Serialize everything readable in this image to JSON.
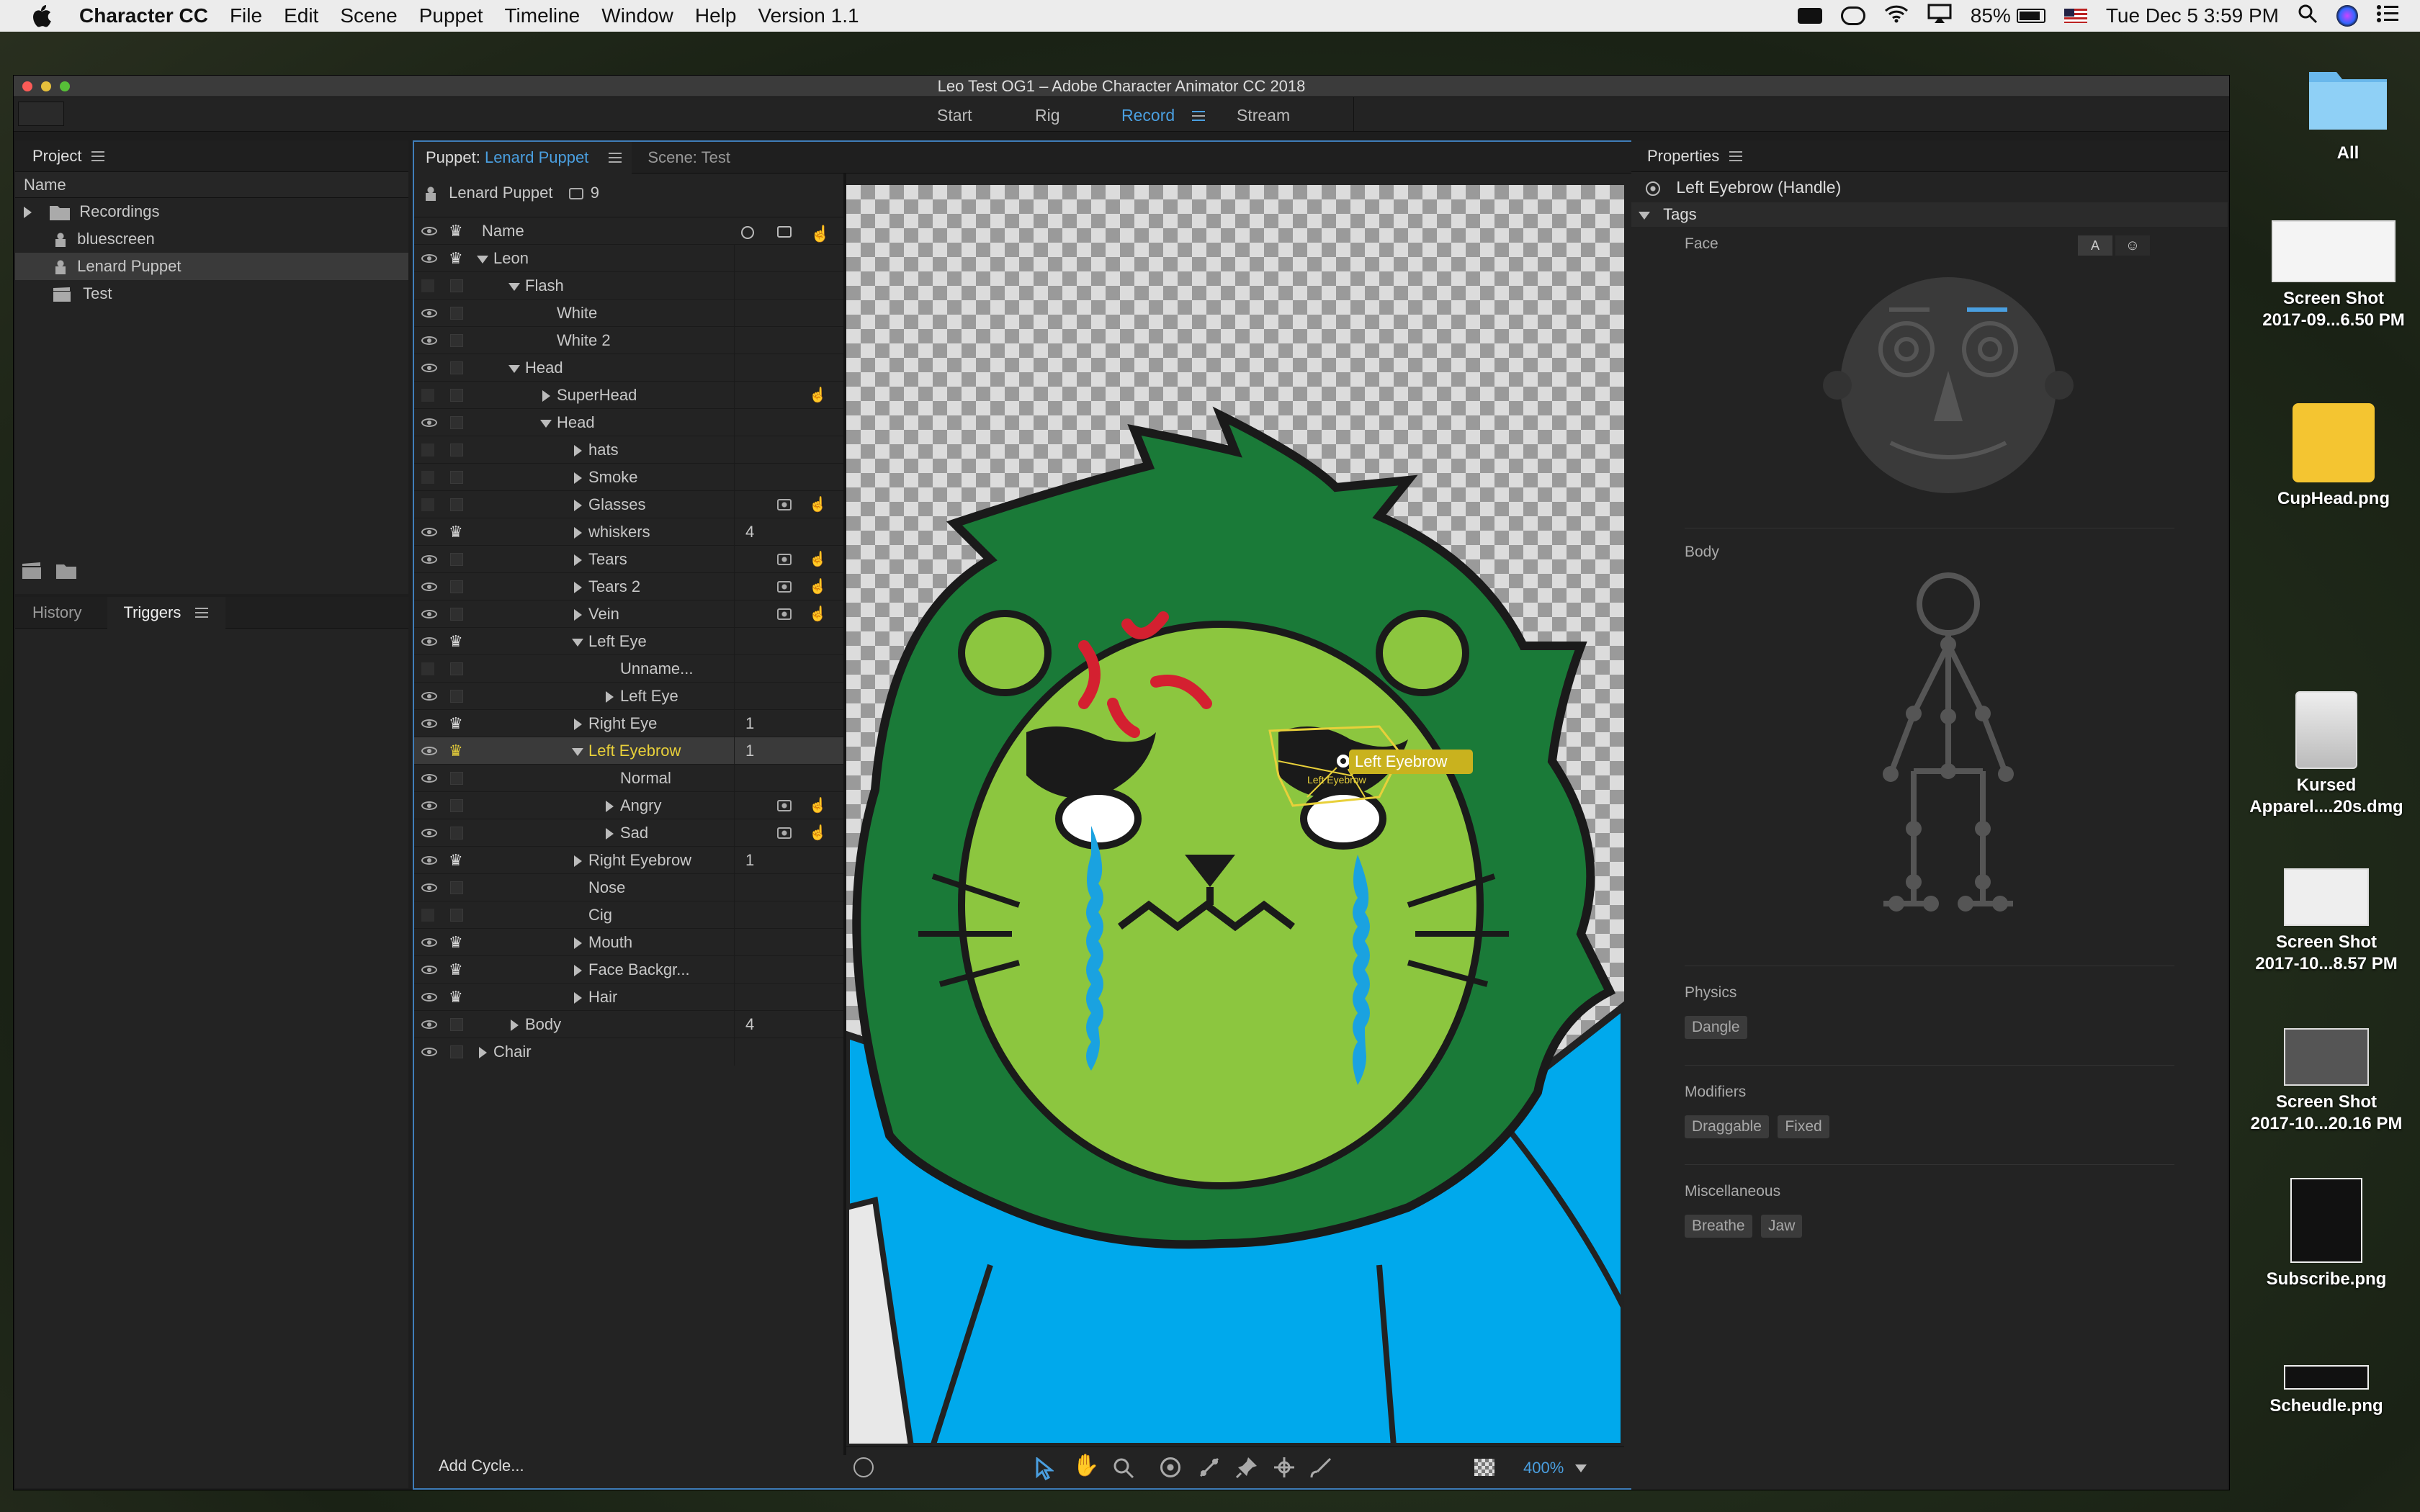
{
  "menubar": {
    "app": "Character CC",
    "items": [
      "File",
      "Edit",
      "Scene",
      "Puppet",
      "Timeline",
      "Window",
      "Help",
      "Version 1.1"
    ],
    "battery": "85%",
    "clock": "Tue Dec 5  3:59 PM"
  },
  "window": {
    "title": "Leo Test OG1 – Adobe Character Animator CC 2018",
    "modes": [
      "Start",
      "Rig",
      "Record",
      "Stream"
    ],
    "active_mode": "Record"
  },
  "project": {
    "title": "Project",
    "col": "Name",
    "items": [
      "Recordings",
      "bluescreen",
      "Lenard Puppet",
      "Test"
    ]
  },
  "lower_tabs": {
    "history": "History",
    "triggers": "Triggers"
  },
  "puppet": {
    "tab_prefix": "Puppet: ",
    "tab_name": "Lenard Puppet",
    "scene_tab": "Scene: Test",
    "header_name": "Lenard Puppet",
    "header_count": "9",
    "col": "Name",
    "add_cycle": "Add Cycle..."
  },
  "layers": [
    {
      "n": "Leon",
      "d": 1,
      "t": "d",
      "crown": true,
      "eye": true
    },
    {
      "n": "Flash",
      "d": 2,
      "t": "d",
      "eye": false
    },
    {
      "n": "White",
      "d": 3,
      "t": "n",
      "eye": true
    },
    {
      "n": "White 2",
      "d": 3,
      "t": "n",
      "eye": true
    },
    {
      "n": "Head",
      "d": 2,
      "t": "d",
      "eye": true
    },
    {
      "n": "SuperHead",
      "d": 3,
      "t": "r",
      "eye": false,
      "hand": true
    },
    {
      "n": "Head",
      "d": 3,
      "t": "d",
      "eye": true
    },
    {
      "n": "hats",
      "d": 4,
      "t": "r",
      "eye": false
    },
    {
      "n": "Smoke",
      "d": 4,
      "t": "r",
      "eye": false
    },
    {
      "n": "Glasses",
      "d": 4,
      "t": "r",
      "eye": false,
      "cam": true,
      "hand": true
    },
    {
      "n": "whiskers",
      "d": 4,
      "t": "r",
      "crown": true,
      "eye": true,
      "num": "4"
    },
    {
      "n": "Tears",
      "d": 4,
      "t": "r",
      "eye": true,
      "cam": true,
      "hand": true
    },
    {
      "n": "Tears 2",
      "d": 4,
      "t": "r",
      "eye": true,
      "cam": true,
      "hand": true
    },
    {
      "n": "Vein",
      "d": 4,
      "t": "r",
      "eye": true,
      "cam": true,
      "hand": true
    },
    {
      "n": "Left Eye",
      "d": 4,
      "t": "d",
      "crown": true,
      "eye": true
    },
    {
      "n": "Unname...",
      "d": 5,
      "t": "n",
      "eye": false
    },
    {
      "n": "Left Eye",
      "d": 5,
      "t": "r",
      "eye": true
    },
    {
      "n": "Right Eye",
      "d": 4,
      "t": "r",
      "crown": true,
      "eye": true,
      "num": "1"
    },
    {
      "n": "Left Eyebrow",
      "d": 4,
      "t": "d",
      "crown": true,
      "eye": true,
      "num": "1",
      "sel": true
    },
    {
      "n": "Normal",
      "d": 5,
      "t": "n",
      "eye": true
    },
    {
      "n": "Angry",
      "d": 5,
      "t": "r",
      "eye": true,
      "cam": true,
      "hand": true
    },
    {
      "n": "Sad",
      "d": 5,
      "t": "r",
      "eye": true,
      "cam": true,
      "hand": true
    },
    {
      "n": "Right Eyebrow",
      "d": 4,
      "t": "r",
      "crown": true,
      "eye": true,
      "num": "1"
    },
    {
      "n": "Nose",
      "d": 4,
      "t": "n",
      "eye": true
    },
    {
      "n": "Cig",
      "d": 4,
      "t": "n",
      "eye": false
    },
    {
      "n": "Mouth",
      "d": 4,
      "t": "r",
      "crown": true,
      "eye": true
    },
    {
      "n": "Face Backgr...",
      "d": 4,
      "t": "r",
      "crown": true,
      "eye": true
    },
    {
      "n": "Hair",
      "d": 4,
      "t": "r",
      "crown": true,
      "eye": true
    },
    {
      "n": "Body",
      "d": 2,
      "t": "r",
      "eye": true,
      "num": "4"
    },
    {
      "n": "Chair",
      "d": 1,
      "t": "r",
      "eye": true
    }
  ],
  "canvas": {
    "handle_label": "Left Eyebrow",
    "handle_sublabel": "Left Eyebrow",
    "zoom": "400%"
  },
  "properties": {
    "title": "Properties",
    "handle": "Left Eyebrow (Handle)",
    "tags": "Tags",
    "face": "Face",
    "face_btn_a": "A",
    "body": "Body",
    "physics": "Physics",
    "physics_tags": [
      "Dangle"
    ],
    "modifiers": "Modifiers",
    "modifier_tags": [
      "Draggable",
      "Fixed"
    ],
    "misc": "Miscellaneous",
    "misc_tags": [
      "Breathe",
      "Jaw"
    ]
  },
  "desktop": [
    {
      "label": "All"
    },
    {
      "label": "Screen Shot\n2017-09...6.50 PM"
    },
    {
      "label": "CupHead.png"
    },
    {
      "label": "Kursed\nApparel....20s.dmg"
    },
    {
      "label": "Screen Shot\n2017-10...8.57 PM"
    },
    {
      "label": "Screen Shot\n2017-10...20.16 PM"
    },
    {
      "label": "Subscribe.png"
    },
    {
      "label": "Scheudle.png"
    }
  ],
  "colors": {
    "accent": "#4a9fe0",
    "selected": "#e8d03a",
    "lion_mane": "#1a7a38",
    "lion_face": "#8cc63f",
    "body": "#00a9ec",
    "tear": "#1aa2e0",
    "vein": "#d42030"
  }
}
